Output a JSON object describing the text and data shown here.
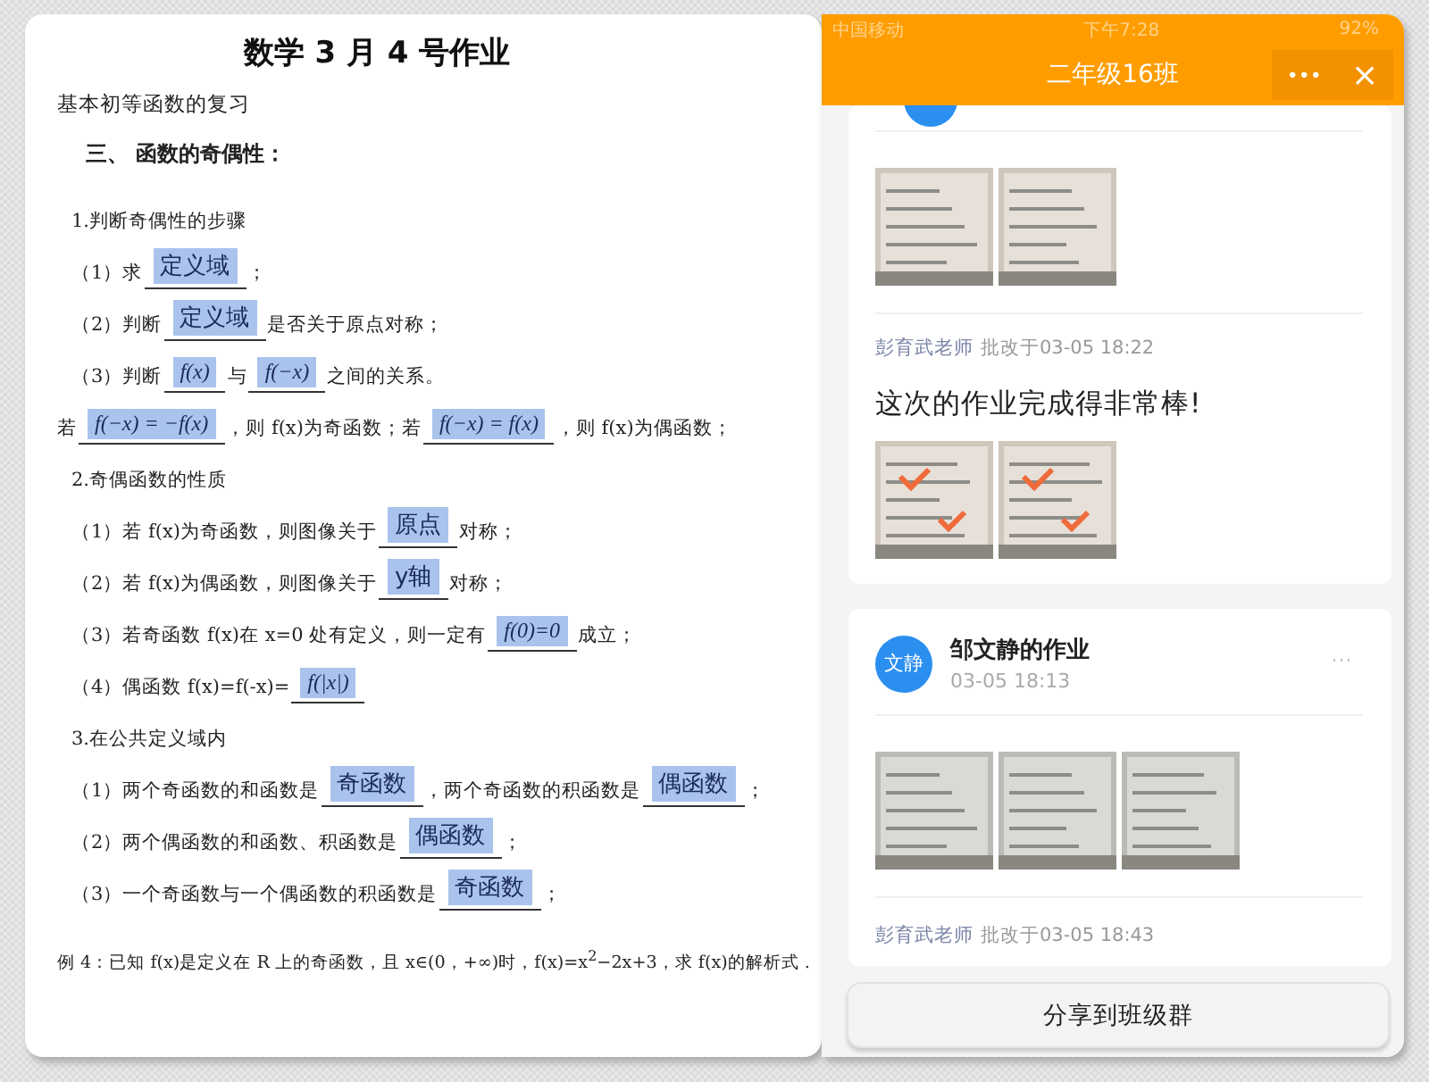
{
  "document": {
    "title": "数学 3 月 4 号作业",
    "subtitle": "基本初等函数的复习",
    "heading": "三、 函数的奇偶性：",
    "lines": [
      {
        "kind": "section",
        "segments": [
          {
            "kind": "text",
            "text": "1.判断奇偶性的步骤"
          }
        ]
      },
      {
        "kind": "item",
        "segments": [
          {
            "kind": "text",
            "text": "（1）求"
          },
          {
            "kind": "blank",
            "answer": "定义域"
          },
          {
            "kind": "text",
            "text": "；"
          }
        ]
      },
      {
        "kind": "item",
        "segments": [
          {
            "kind": "text",
            "text": "（2）判断"
          },
          {
            "kind": "blank",
            "answer": "定义域"
          },
          {
            "kind": "text",
            "text": "是否关于原点对称；"
          }
        ]
      },
      {
        "kind": "item",
        "segments": [
          {
            "kind": "text",
            "text": "（3）判断"
          },
          {
            "kind": "formula",
            "answer": "f(x)"
          },
          {
            "kind": "text",
            "text": "与"
          },
          {
            "kind": "formula",
            "answer": "f(−x)"
          },
          {
            "kind": "text",
            "text": "之间的关系。"
          }
        ]
      },
      {
        "kind": "plain",
        "segments": [
          {
            "kind": "text",
            "text": "若"
          },
          {
            "kind": "formula",
            "answer": "f(−x) = −f(x)"
          },
          {
            "kind": "text",
            "text": "，则 f(x)为奇函数；若"
          },
          {
            "kind": "formula",
            "answer": "f(−x) = f(x)"
          },
          {
            "kind": "text",
            "text": "，则 f(x)为偶函数；"
          }
        ]
      },
      {
        "kind": "section",
        "segments": [
          {
            "kind": "text",
            "text": "2.奇偶函数的性质"
          }
        ]
      },
      {
        "kind": "item",
        "segments": [
          {
            "kind": "text",
            "text": "（1）若 f(x)为奇函数，则图像关于"
          },
          {
            "kind": "blank",
            "answer": "原点"
          },
          {
            "kind": "text",
            "text": "对称；"
          }
        ]
      },
      {
        "kind": "item",
        "segments": [
          {
            "kind": "text",
            "text": "（2）若 f(x)为偶函数，则图像关于"
          },
          {
            "kind": "blank",
            "answer": "y轴"
          },
          {
            "kind": "text",
            "text": "对称；"
          }
        ]
      },
      {
        "kind": "item",
        "segments": [
          {
            "kind": "text",
            "text": "（3）若奇函数 f(x)在 x=0 处有定义，则一定有"
          },
          {
            "kind": "formula",
            "answer": "f(0)=0"
          },
          {
            "kind": "text",
            "text": "成立；"
          }
        ]
      },
      {
        "kind": "item",
        "segments": [
          {
            "kind": "text",
            "text": "（4）偶函数 f(x)=f(-x)="
          },
          {
            "kind": "formula",
            "answer": "f(|x|)"
          }
        ]
      },
      {
        "kind": "section",
        "segments": [
          {
            "kind": "text",
            "text": "3.在公共定义域内"
          }
        ]
      },
      {
        "kind": "item",
        "segments": [
          {
            "kind": "text",
            "text": "（1）两个奇函数的和函数是"
          },
          {
            "kind": "blank",
            "answer": "奇函数"
          },
          {
            "kind": "text",
            "text": "，两个奇函数的积函数是"
          },
          {
            "kind": "blank",
            "answer": "偶函数"
          },
          {
            "kind": "text",
            "text": "；"
          }
        ]
      },
      {
        "kind": "item",
        "segments": [
          {
            "kind": "text",
            "text": "（2）两个偶函数的和函数、积函数是"
          },
          {
            "kind": "blank",
            "answer": "偶函数"
          },
          {
            "kind": "text",
            "text": "；"
          }
        ]
      },
      {
        "kind": "item",
        "segments": [
          {
            "kind": "text",
            "text": "（3）一个奇函数与一个偶函数的积函数是"
          },
          {
            "kind": "blank",
            "answer": "奇函数"
          },
          {
            "kind": "text",
            "text": "；"
          }
        ]
      },
      {
        "kind": "plain",
        "segments": [
          {
            "kind": "text",
            "text": "例 4：已知 f(x)是定义在 R 上的奇函数，且 x∈(0，+∞)时，f(x)=x$^{2}$−2x+3，求 f(x)的解析式 ."
          }
        ]
      }
    ]
  },
  "phone": {
    "status_bar": {
      "carrier": "中国移动",
      "time": "下午7:28",
      "battery": "92%"
    },
    "nav": {
      "title": "二年级16班",
      "more_button": "•••",
      "close_button": "×"
    },
    "posts": [
      {
        "partial": true,
        "images": [
          {
            "kind": "picture",
            "marked": false
          },
          {
            "kind": "picture",
            "marked": false
          }
        ],
        "review": {
          "teacher": "彭育武老师",
          "meta": "批改于03-05 18:22",
          "comment": "这次的作业完成得非常棒!",
          "images": [
            {
              "kind": "picture",
              "marked": true
            },
            {
              "kind": "picture",
              "marked": true
            }
          ]
        }
      },
      {
        "partial": false,
        "avatar": "文静",
        "name": "邹文静的作业",
        "time": "03-05 18:13",
        "more": "···",
        "images": [
          {
            "kind": "picture",
            "marked": false
          },
          {
            "kind": "picture",
            "marked": false
          },
          {
            "kind": "picture",
            "marked": false
          }
        ],
        "review": {
          "teacher": "彭育武老师",
          "meta": "批改于03-05 18:43"
        }
      }
    ],
    "share_button": "分享到班级群"
  }
}
